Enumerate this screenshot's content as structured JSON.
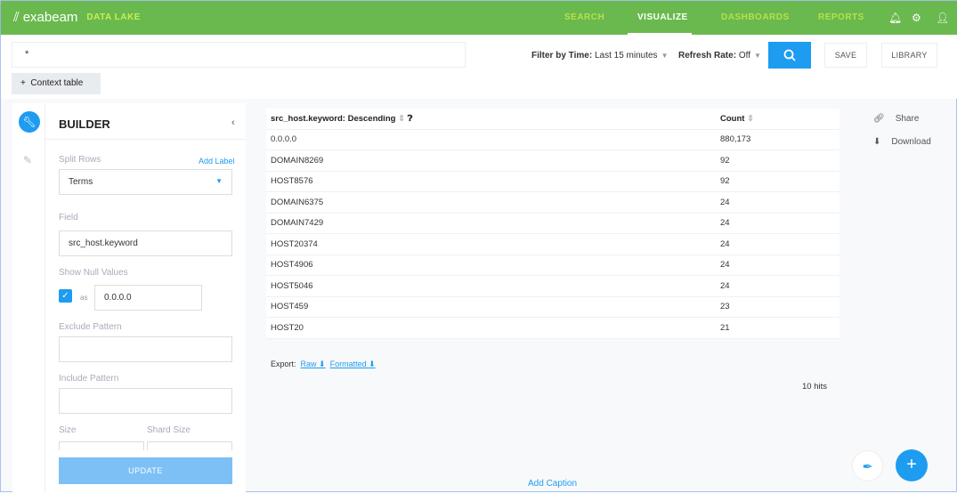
{
  "header": {
    "brand": "exabeam",
    "product": "DATA LAKE",
    "nav": [
      {
        "label": "SEARCH",
        "active": false
      },
      {
        "label": "VISUALIZE",
        "active": true
      },
      {
        "label": "DASHBOARDS",
        "active": false
      },
      {
        "label": "REPORTS",
        "active": false
      }
    ],
    "icons": [
      "bell-icon",
      "gear-icon",
      "user-icon"
    ]
  },
  "toolbar": {
    "query": "*",
    "context_table": "Context table",
    "filter_label": "Filter by Time:",
    "filter_value": "Last 15 minutes",
    "refresh_label": "Refresh Rate:",
    "refresh_value": "Off",
    "save": "SAVE",
    "library": "LIBRARY"
  },
  "builder": {
    "title": "BUILDER",
    "split_rows": "Split Rows",
    "add_label": "Add Label",
    "agg": "Terms",
    "field_label": "Field",
    "field_value": "src_host.keyword",
    "null_label": "Show Null Values",
    "null_checked": true,
    "as": "as",
    "null_value": "0.0.0.0",
    "exclude": "Exclude Pattern",
    "include": "Include Pattern",
    "size": "Size",
    "shard": "Shard Size",
    "update": "UPDATE"
  },
  "table": {
    "headers": [
      "src_host.keyword: Descending",
      "Count"
    ],
    "rows": [
      [
        "0.0.0.0",
        "880,173"
      ],
      [
        "DOMAIN8269",
        "92"
      ],
      [
        "HOST8576",
        "92"
      ],
      [
        "DOMAIN6375",
        "24"
      ],
      [
        "DOMAIN7429",
        "24"
      ],
      [
        "HOST20374",
        "24"
      ],
      [
        "HOST4906",
        "24"
      ],
      [
        "HOST5046",
        "24"
      ],
      [
        "HOST459",
        "23"
      ],
      [
        "HOST20",
        "21"
      ]
    ]
  },
  "export": {
    "label": "Export:",
    "raw": "Raw",
    "formatted": "Formatted"
  },
  "hits": "10 hits",
  "actions": {
    "share": "Share",
    "download": "Download"
  },
  "caption": "Add Caption",
  "colors": {
    "header": "#6ab94f",
    "accent": "#1e9cf0"
  }
}
